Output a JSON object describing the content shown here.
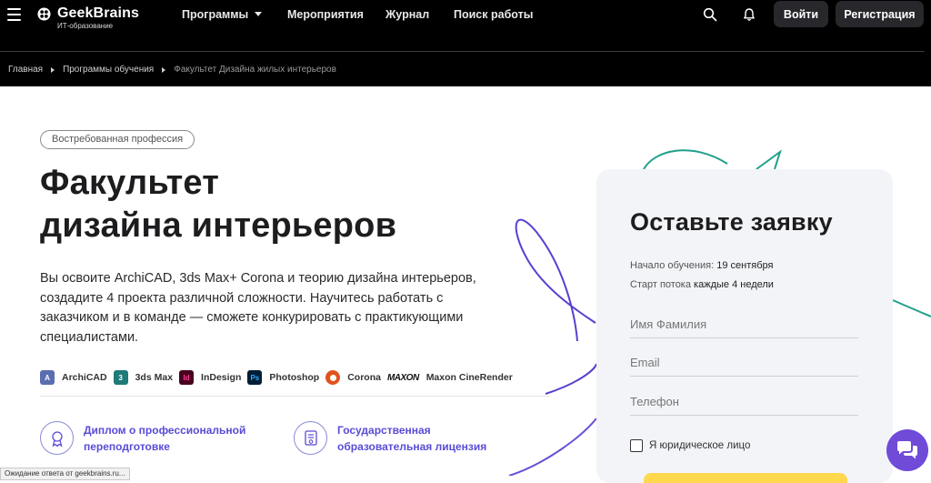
{
  "header": {
    "logo": {
      "name": "GeekBrains",
      "tagline": "ИТ-образование"
    },
    "nav": [
      {
        "label": "Программы",
        "has_dropdown": true
      },
      {
        "label": "Мероприятия"
      },
      {
        "label": "Журнал"
      },
      {
        "label": "Поиск работы"
      }
    ],
    "icons": [
      "search-icon",
      "bell-icon"
    ],
    "login_label": "Войти",
    "register_label": "Регистрация"
  },
  "breadcrumb": [
    "Главная",
    "Программы обучения",
    "Факультет Дизайна жилых интерьеров"
  ],
  "hero": {
    "badge": "Востребованная профессия",
    "title_line1": "Факультет",
    "title_line2": "дизайна интерьеров",
    "description": "Вы освоите ArchiCAD, 3ds Max+ Corona и теорию дизайна интерьеров, создадите 4 проекта различной сложности. Научитесь работать с заказчиком и в команде — сможете конкурировать с практикующими специалистами."
  },
  "tools": [
    {
      "label": "ArchiCAD",
      "icon": "archicad-icon",
      "color": "#5a6eb0",
      "glyph": "A"
    },
    {
      "label": "3ds Max",
      "icon": "3dsmax-icon",
      "color": "#1f7a7a",
      "glyph": "3"
    },
    {
      "label": "InDesign",
      "icon": "indesign-icon",
      "color": "#49021f",
      "glyph": "Id"
    },
    {
      "label": "Photoshop",
      "icon": "photoshop-icon",
      "color": "#001e36",
      "glyph": "Ps"
    },
    {
      "label": "Corona",
      "icon": "corona-icon",
      "color": "#e2521d",
      "glyph": ""
    },
    {
      "label": "",
      "icon": "maxon-logo",
      "color": "#111111",
      "glyph": "MAXON"
    },
    {
      "label": "Maxon CineRender",
      "icon": "",
      "color": "",
      "glyph": ""
    }
  ],
  "features": [
    {
      "line1": "Диплом о профессиональной",
      "line2": "переподготовке",
      "icon": "diploma-seal-icon"
    },
    {
      "line1": "Государственная",
      "line2": "образовательная лицензия",
      "icon": "license-document-icon"
    }
  ],
  "form": {
    "title": "Оставьте заявку",
    "start_label": "Начало обучения:",
    "start_value": "19 сентября",
    "stream_label": "Старт потока",
    "stream_value": "каждые 4 недели",
    "name_placeholder": "Имя Фамилия",
    "email_placeholder": "Email",
    "phone_placeholder": "Телефон",
    "legal_entity_label": "Я юридическое лицо"
  },
  "status_bar": "Ожидание ответа от geekbrains.ru...",
  "colors": {
    "header_bg": "#000000",
    "accent_purple": "#5a4bd6",
    "chat_button": "#6f4bd8",
    "submit_yellow": "#ffd84d",
    "card_bg": "#f3f4f8"
  }
}
